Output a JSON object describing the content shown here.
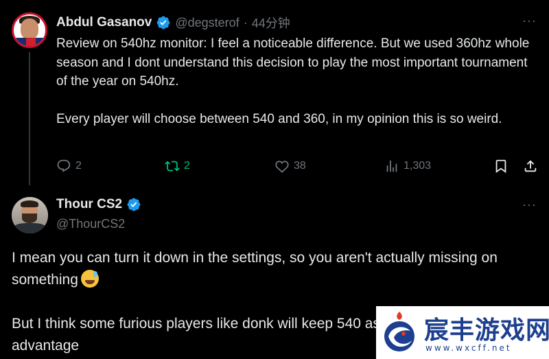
{
  "tweet1": {
    "author_name": "Abdul Gasanov",
    "author_handle": "@degsterof",
    "separator": "·",
    "time": "44分钟",
    "more_label": "···",
    "body": [
      "Review on 540hz monitor: I feel a noticeable difference. But we used 360hz whole season and I dont understand this decision to play the most important tournament of the year on 540hz.",
      "Every player will choose between 540 and 360, in my opinion this is so weird."
    ],
    "stats": {
      "replies": "2",
      "retweets": "2",
      "likes": "38",
      "views": "1,303"
    }
  },
  "tweet2": {
    "author_name": "Thour CS2",
    "author_handle": "@ThourCS2",
    "more_label": "···",
    "body_line1": "I mean you can turn it down in the settings, so you aren't actually missing on something",
    "body_line2": "But I think some furious players like donk will keep 540 as it gives obvious advantage"
  },
  "watermark": {
    "title": "宸丰游戏网",
    "url": "www.wxcff.net"
  },
  "colors": {
    "background": "#000000",
    "text": "#e7e9ea",
    "muted": "#71767b",
    "verified": "#1d9bf0",
    "retweet_active": "#00ba7c",
    "thread_line": "#333639"
  },
  "icons": [
    "verified-badge-icon",
    "reply-icon",
    "retweet-icon",
    "like-icon",
    "views-icon",
    "bookmark-icon",
    "share-icon",
    "more-icon",
    "grin-sweat-emoji"
  ]
}
